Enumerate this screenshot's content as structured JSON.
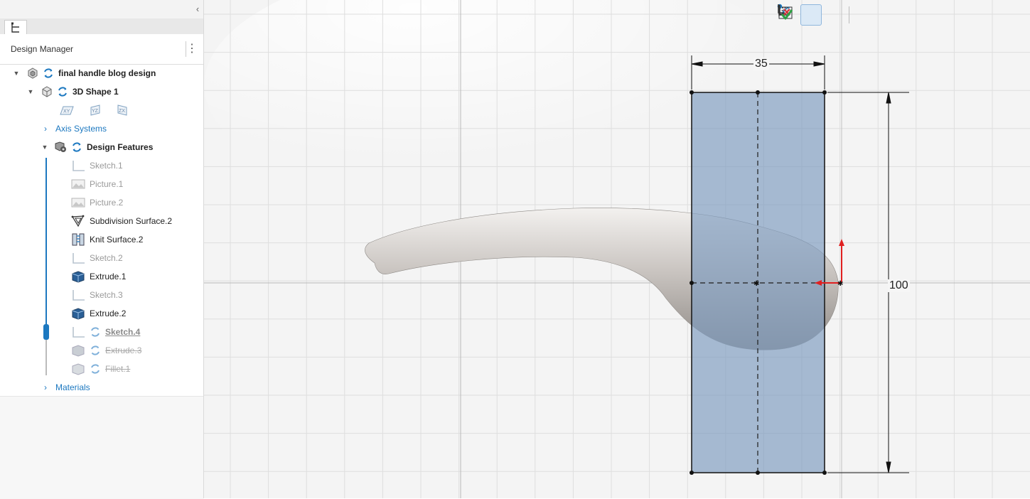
{
  "panel": {
    "title": "Design Manager",
    "menu_glyph": "⋮",
    "collapse_glyph": "‹"
  },
  "tree": {
    "root": {
      "label": "final handle blog design",
      "icon": "part-icon"
    },
    "shape": {
      "label": "3D Shape 1",
      "icon": "shape-icon"
    },
    "planes": [
      "XY",
      "YZ",
      "ZX"
    ],
    "axis_systems": "Axis Systems",
    "design_features": "Design Features",
    "features": [
      {
        "label": "Sketch.1",
        "icon": "sketch-icon",
        "state": "dim"
      },
      {
        "label": "Picture.1",
        "icon": "picture-icon",
        "state": "dim"
      },
      {
        "label": "Picture.2",
        "icon": "picture-icon",
        "state": "dim"
      },
      {
        "label": "Subdivision Surface.2",
        "icon": "subdivision-surface-icon",
        "state": "normal"
      },
      {
        "label": "Knit Surface.2",
        "icon": "knit-surface-icon",
        "state": "normal"
      },
      {
        "label": "Sketch.2",
        "icon": "sketch-icon",
        "state": "dim"
      },
      {
        "label": "Extrude.1",
        "icon": "extrude-icon",
        "state": "normal"
      },
      {
        "label": "Sketch.3",
        "icon": "sketch-icon",
        "state": "dim"
      },
      {
        "label": "Extrude.2",
        "icon": "extrude-icon",
        "state": "normal"
      },
      {
        "label": "Sketch.4",
        "icon": "sketch-icon",
        "state": "editing"
      },
      {
        "label": "Extrude.3",
        "icon": "extrude-icon",
        "state": "suppressed"
      },
      {
        "label": "Fillet.1",
        "icon": "fillet-icon",
        "state": "suppressed"
      }
    ],
    "materials": "Materials"
  },
  "toolbar": {
    "buttons": [
      "sketch-grid-icon",
      "constraint-icon",
      "auto-dimension-icon",
      "exit-cancel-icon",
      "exit-confirm-icon"
    ]
  },
  "sketch": {
    "width_dimension": "35",
    "height_dimension": "100"
  },
  "colors": {
    "accent": "#1c78c0",
    "sketch_fill": "#8fa9c6",
    "confirm": "#2ea043",
    "cancel": "#d9363e",
    "axis_red": "#e02020"
  }
}
